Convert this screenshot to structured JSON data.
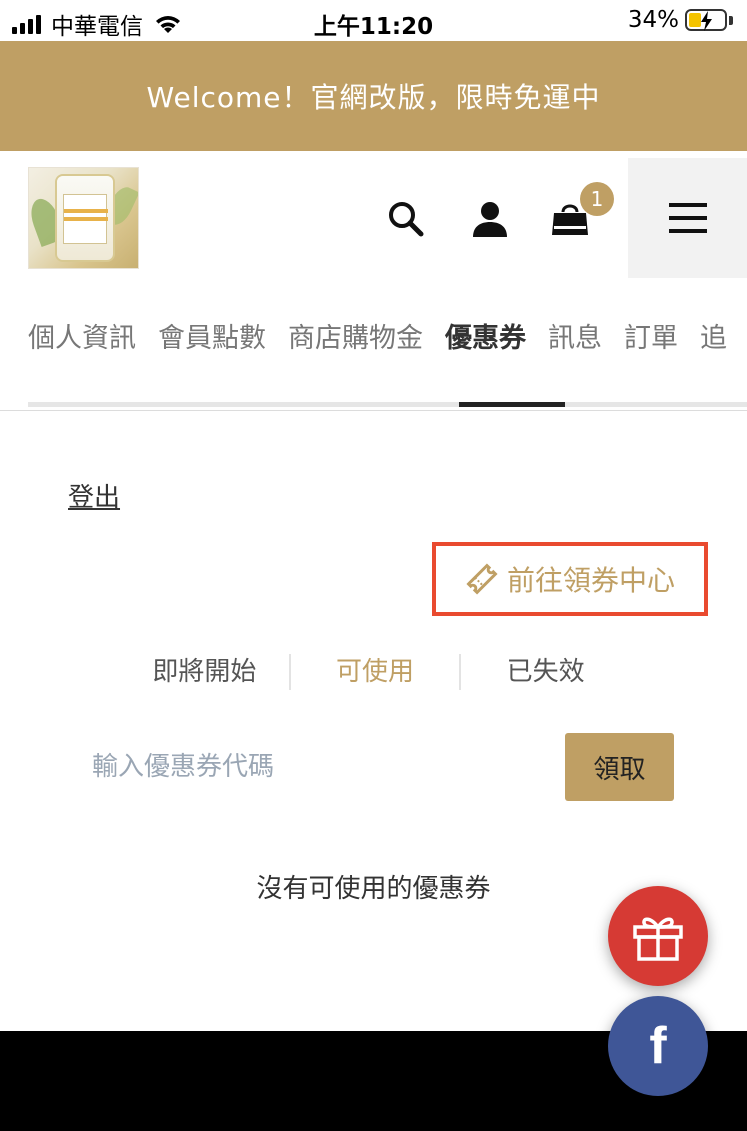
{
  "status_bar": {
    "carrier": "中華電信",
    "time": "上午11:20",
    "battery": "34%"
  },
  "banner": {
    "text": "Welcome！官網改版，限時免運中"
  },
  "header": {
    "logo_alt": "PINEAPPLE COCONUT",
    "cart_count": "1",
    "icons": {
      "search": "search-icon",
      "user": "user-icon",
      "cart": "shopping-bag-icon",
      "menu": "hamburger-menu-icon"
    }
  },
  "tabs": [
    {
      "label": "個人資訊",
      "active": false
    },
    {
      "label": "會員點數",
      "active": false
    },
    {
      "label": "商店購物金",
      "active": false
    },
    {
      "label": "優惠券",
      "active": true
    },
    {
      "label": "訊息",
      "active": false
    },
    {
      "label": "訂單",
      "active": false
    },
    {
      "label": "追",
      "active": false
    }
  ],
  "content": {
    "logout": "登出",
    "coupon_center": "前往領券中心",
    "filters": [
      {
        "label": "即將開始",
        "active": false
      },
      {
        "label": "可使用",
        "active": true
      },
      {
        "label": "已失效",
        "active": false
      }
    ],
    "code_input": {
      "placeholder": "輸入優惠券代碼",
      "value": ""
    },
    "claim_button": "領取",
    "empty_message": "沒有可使用的優惠券"
  },
  "colors": {
    "brand_gold": "#bf9f64",
    "highlight_red": "#e94a2f",
    "gift_red": "#d63a34",
    "facebook_blue": "#3f5697"
  }
}
